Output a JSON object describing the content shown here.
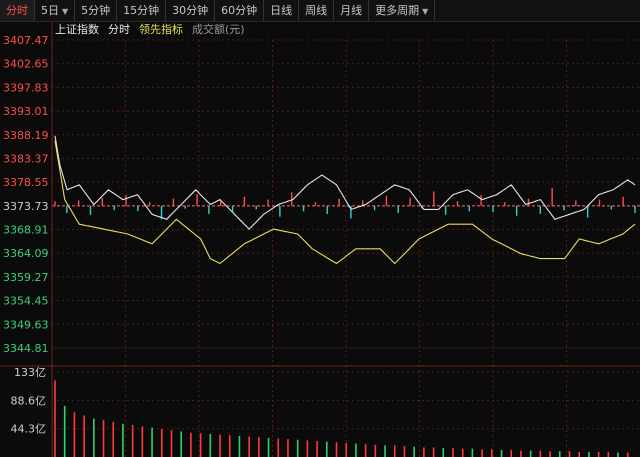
{
  "toolbar": {
    "items": [
      {
        "label": "分时",
        "active": true
      },
      {
        "label": "5日",
        "dropdown": true
      },
      {
        "label": "5分钟"
      },
      {
        "label": "15分钟"
      },
      {
        "label": "30分钟"
      },
      {
        "label": "60分钟"
      },
      {
        "label": "日线"
      },
      {
        "label": "周线"
      },
      {
        "label": "月线"
      },
      {
        "label": "更多周期",
        "dropdown": true
      }
    ]
  },
  "legend": {
    "index_name": "上证指数",
    "tab_label": "分时",
    "leading_label": "领先指标",
    "volume_label": "成交额(元)"
  },
  "colors": {
    "up": "#ff4d4d",
    "down": "#2bd3d3",
    "price_line": "#e6e6e6",
    "leading_line": "#e8e05a",
    "grid": "#5a1a1a",
    "vol_up": "#ff3b3b",
    "vol_down": "#2fd36a"
  },
  "chart_data": {
    "type": "line",
    "price_axis": {
      "ticks": [
        "3407.47",
        "3402.65",
        "3397.83",
        "3393.01",
        "3388.19",
        "3383.37",
        "3378.55",
        "3373.73",
        "3368.91",
        "3364.09",
        "3359.27",
        "3354.45",
        "3349.63",
        "3344.81"
      ],
      "ylim": [
        3344.81,
        3407.47
      ],
      "prev_close": 3373.73
    },
    "volume_axis": {
      "ticks": [
        "133亿",
        "88.6亿",
        "44.3亿"
      ],
      "ylim": [
        0,
        133
      ]
    },
    "x_count": 240,
    "series": [
      {
        "key": "price",
        "points": [
          [
            0,
            3388
          ],
          [
            2,
            3382
          ],
          [
            5,
            3377
          ],
          [
            10,
            3378
          ],
          [
            16,
            3374
          ],
          [
            22,
            3377
          ],
          [
            28,
            3375
          ],
          [
            34,
            3376
          ],
          [
            40,
            3372
          ],
          [
            46,
            3371
          ],
          [
            52,
            3374
          ],
          [
            58,
            3377
          ],
          [
            64,
            3374
          ],
          [
            68,
            3375
          ],
          [
            74,
            3372
          ],
          [
            80,
            3369
          ],
          [
            86,
            3372
          ],
          [
            92,
            3374
          ],
          [
            98,
            3375
          ],
          [
            104,
            3378
          ],
          [
            110,
            3380
          ],
          [
            116,
            3378
          ],
          [
            122,
            3373
          ],
          [
            128,
            3374
          ],
          [
            134,
            3376
          ],
          [
            140,
            3378
          ],
          [
            146,
            3377
          ],
          [
            152,
            3373
          ],
          [
            158,
            3373
          ],
          [
            164,
            3376
          ],
          [
            170,
            3377
          ],
          [
            176,
            3375
          ],
          [
            182,
            3376
          ],
          [
            188,
            3378
          ],
          [
            194,
            3374
          ],
          [
            200,
            3375
          ],
          [
            206,
            3371
          ],
          [
            212,
            3372
          ],
          [
            218,
            3373
          ],
          [
            224,
            3376
          ],
          [
            230,
            3377
          ],
          [
            236,
            3379
          ],
          [
            239,
            3378
          ]
        ]
      },
      {
        "key": "leading",
        "points": [
          [
            0,
            3387
          ],
          [
            4,
            3375
          ],
          [
            10,
            3370
          ],
          [
            20,
            3369
          ],
          [
            30,
            3368
          ],
          [
            40,
            3366
          ],
          [
            50,
            3371
          ],
          [
            60,
            3367
          ],
          [
            64,
            3363
          ],
          [
            68,
            3362
          ],
          [
            78,
            3366
          ],
          [
            90,
            3369
          ],
          [
            100,
            3368
          ],
          [
            106,
            3365
          ],
          [
            116,
            3362
          ],
          [
            124,
            3365
          ],
          [
            134,
            3365
          ],
          [
            140,
            3362
          ],
          [
            150,
            3367
          ],
          [
            162,
            3370
          ],
          [
            172,
            3370
          ],
          [
            180,
            3367
          ],
          [
            192,
            3364
          ],
          [
            200,
            3363
          ],
          [
            210,
            3363
          ],
          [
            216,
            3367
          ],
          [
            224,
            3366
          ],
          [
            234,
            3368
          ],
          [
            239,
            3370
          ]
        ]
      }
    ],
    "bars": [
      0.5,
      -0.8,
      0.6,
      -1.0,
      0.9,
      -0.5,
      1.2,
      -0.6,
      0.4,
      -1.5,
      0.8,
      -0.3,
      1.3,
      -0.9,
      0.5,
      -0.7,
      1.0,
      -0.4,
      0.7,
      -1.2,
      1.5,
      -0.6,
      0.4,
      -0.9,
      0.8,
      -1.4,
      0.6,
      -0.5,
      1.1,
      -0.8,
      0.9,
      -0.3,
      1.6,
      -1.0,
      0.5,
      -0.6,
      1.2,
      -0.7,
      0.4,
      -1.1,
      0.8,
      -0.9,
      2.0,
      -0.5,
      0.6,
      -1.3,
      0.7,
      -0.4,
      1.0,
      -0.8
    ],
    "volume": [
      120,
      80,
      70,
      65,
      60,
      58,
      55,
      52,
      50,
      48,
      46,
      44,
      42,
      40,
      38,
      37,
      36,
      35,
      34,
      33,
      32,
      31,
      30,
      29,
      28,
      27,
      26,
      25,
      24,
      23,
      22,
      21,
      20,
      19,
      18,
      18,
      17,
      16,
      15,
      15,
      14,
      14,
      13,
      13,
      12,
      12,
      11,
      11,
      10,
      10,
      10,
      9,
      9,
      9,
      8,
      8,
      8,
      8,
      7,
      7
    ]
  }
}
